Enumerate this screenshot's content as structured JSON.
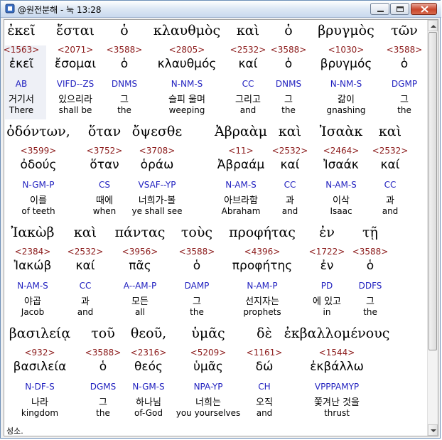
{
  "window": {
    "title": "@원전분해 - 눅 13:28",
    "minimize_icon": "minimize-icon",
    "maximize_icon": "maximize-icon",
    "close_icon": "close-icon"
  },
  "lines": [
    {
      "words": [
        {
          "greek": "ἐκεῖ",
          "strong": "<1563>",
          "lexical": "ἐκεῖ",
          "parse": "AB",
          "korean": "거기서",
          "english": "There"
        },
        {
          "greek": "ἔσται",
          "strong": "<2071>",
          "lexical": "ἔσομαι",
          "parse": "VIFD--ZS",
          "korean": "있으리라",
          "english": "shall be"
        },
        {
          "greek": "ὁ",
          "strong": "<3588>",
          "lexical": "ὁ",
          "parse": "DNMS",
          "korean": "그",
          "english": "the"
        },
        {
          "greek": "κλαυθμὸς",
          "strong": "<2805>",
          "lexical": "κλαυθμός",
          "parse": "N-NM-S",
          "korean": "슬피 울며",
          "english": "weeping"
        },
        {
          "greek": "καὶ",
          "strong": "<2532>",
          "lexical": "καί",
          "parse": "CC",
          "korean": "그리고",
          "english": "and"
        },
        {
          "greek": "ὁ",
          "strong": "<3588>",
          "lexical": "ὁ",
          "parse": "DNMS",
          "korean": "그",
          "english": "the"
        },
        {
          "greek": "βρυγμὸς",
          "strong": "<1030>",
          "lexical": "βρυγμός",
          "parse": "N-NM-S",
          "korean": "갊이",
          "english": "gnashing"
        },
        {
          "greek": "τῶν",
          "strong": "<3588>",
          "lexical": "ὁ",
          "parse": "DGMP",
          "korean": "그",
          "english": "the"
        }
      ]
    },
    {
      "words": [
        {
          "greek": "ὀδόντων,",
          "strong": "<3599>",
          "lexical": "ὀδούς",
          "parse": "N-GM-P",
          "korean": "이를",
          "english": "of teeth"
        },
        {
          "greek": "ὅταν",
          "strong": "<3752>",
          "lexical": "ὅταν",
          "parse": "CS",
          "korean": "때에",
          "english": "when"
        },
        {
          "greek": "ὄψεσθε",
          "strong": "<3708>",
          "lexical": "ὁράω",
          "parse": "VSAF--YP",
          "korean": "너희가-볼",
          "english": "ye shall see"
        },
        {
          "greek": "Ἀβραὰμ",
          "strong": "<11>",
          "lexical": "Ἀβραάμ",
          "parse": "N-AM-S",
          "korean": "아브라함",
          "english": "Abraham"
        },
        {
          "greek": "καὶ",
          "strong": "<2532>",
          "lexical": "καί",
          "parse": "CC",
          "korean": "과",
          "english": "and"
        },
        {
          "greek": "Ἰσαὰκ",
          "strong": "<2464>",
          "lexical": "Ἰσαάκ",
          "parse": "N-AM-S",
          "korean": "이삭",
          "english": "Isaac"
        },
        {
          "greek": "καὶ",
          "strong": "<2532>",
          "lexical": "καί",
          "parse": "CC",
          "korean": "과",
          "english": "and"
        }
      ]
    },
    {
      "words": [
        {
          "greek": "Ἰακὼβ",
          "strong": "<2384>",
          "lexical": "Ἰακώβ",
          "parse": "N-AM-S",
          "korean": "야곱",
          "english": "Jacob"
        },
        {
          "greek": "καὶ",
          "strong": "<2532>",
          "lexical": "καί",
          "parse": "CC",
          "korean": "과",
          "english": "and"
        },
        {
          "greek": "πάντας",
          "strong": "<3956>",
          "lexical": "πᾶς",
          "parse": "A--AM-P",
          "korean": "모든",
          "english": "all"
        },
        {
          "greek": "τοὺς",
          "strong": "<3588>",
          "lexical": "ὁ",
          "parse": "DAMP",
          "korean": "그",
          "english": "the"
        },
        {
          "greek": "προφήτας",
          "strong": "<4396>",
          "lexical": "προφήτης",
          "parse": "N-AM-P",
          "korean": "선지자는",
          "english": "prophets"
        },
        {
          "greek": "ἐν",
          "strong": "<1722>",
          "lexical": "ἐν",
          "parse": "PD",
          "korean": "에 있고",
          "english": "in"
        },
        {
          "greek": "τῇ",
          "strong": "<3588>",
          "lexical": "ὁ",
          "parse": "DDFS",
          "korean": "그",
          "english": "the"
        }
      ]
    },
    {
      "words": [
        {
          "greek": "βασιλείᾳ",
          "strong": "<932>",
          "lexical": "βασιλεία",
          "parse": "N-DF-S",
          "korean": "나라",
          "english": "kingdom"
        },
        {
          "greek": "τοῦ",
          "strong": "<3588>",
          "lexical": "ὁ",
          "parse": "DGMS",
          "korean": "그",
          "english": "the"
        },
        {
          "greek": "θεοῦ,",
          "strong": "<2316>",
          "lexical": "θεός",
          "parse": "N-GM-S",
          "korean": "하나님",
          "english": "of-God"
        },
        {
          "greek": "ὑμᾶς",
          "strong": "<5209>",
          "lexical": "ὑμᾶς",
          "parse": "NPA-YP",
          "korean": "너희는",
          "english": "you yourselves"
        },
        {
          "greek": "δὲ",
          "strong": "<1161>",
          "lexical": "δώ",
          "parse": "CH",
          "korean": "오직",
          "english": "and"
        },
        {
          "greek": "ἐκβαλλομένους",
          "strong": "<1544>",
          "lexical": "ἐκβάλλω",
          "parse": "VPPPAMYP",
          "korean": "쫓겨난 것을",
          "english": "thrust"
        }
      ]
    }
  ],
  "cut_text": "성소."
}
